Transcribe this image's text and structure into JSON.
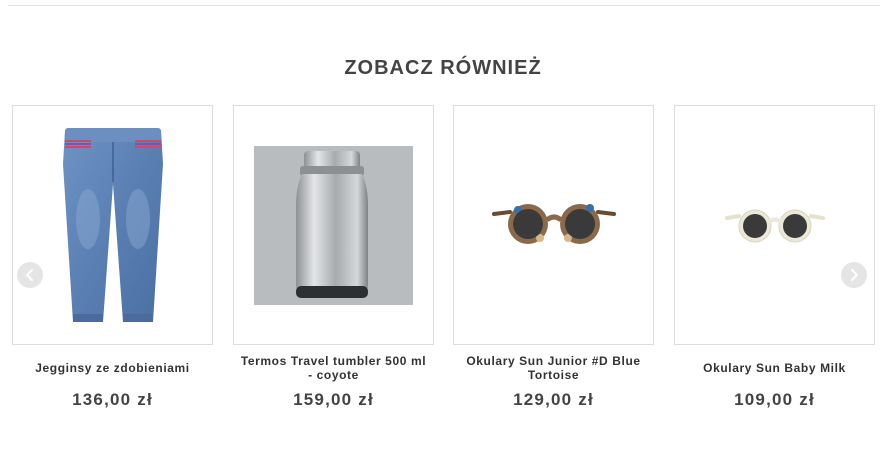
{
  "section": {
    "title": "ZOBACZ RÓWNIEŻ"
  },
  "carousel": {
    "prev_icon": "chevron-left-icon",
    "next_icon": "chevron-right-icon",
    "products": [
      {
        "name": "Jegginsy ze zdobieniami",
        "price": "136,00 zł",
        "image": "jeans-icon"
      },
      {
        "name": "Termos Travel tumbler 500 ml - coyote",
        "price": "159,00 zł",
        "image": "thermos-icon"
      },
      {
        "name": "Okulary Sun Junior #D Blue Tortoise",
        "price": "129,00 zł",
        "image": "tortoise-sunglasses-icon"
      },
      {
        "name": "Okulary Sun Baby Milk",
        "price": "109,00 zł",
        "image": "white-sunglasses-icon"
      }
    ]
  },
  "colors": {
    "denim": "#5b80b3",
    "thermos_bg": "#b9bcbe",
    "steel": "#c7c9cc",
    "lens": "#3a3a3a",
    "milk_frame": "#ece8d8"
  }
}
